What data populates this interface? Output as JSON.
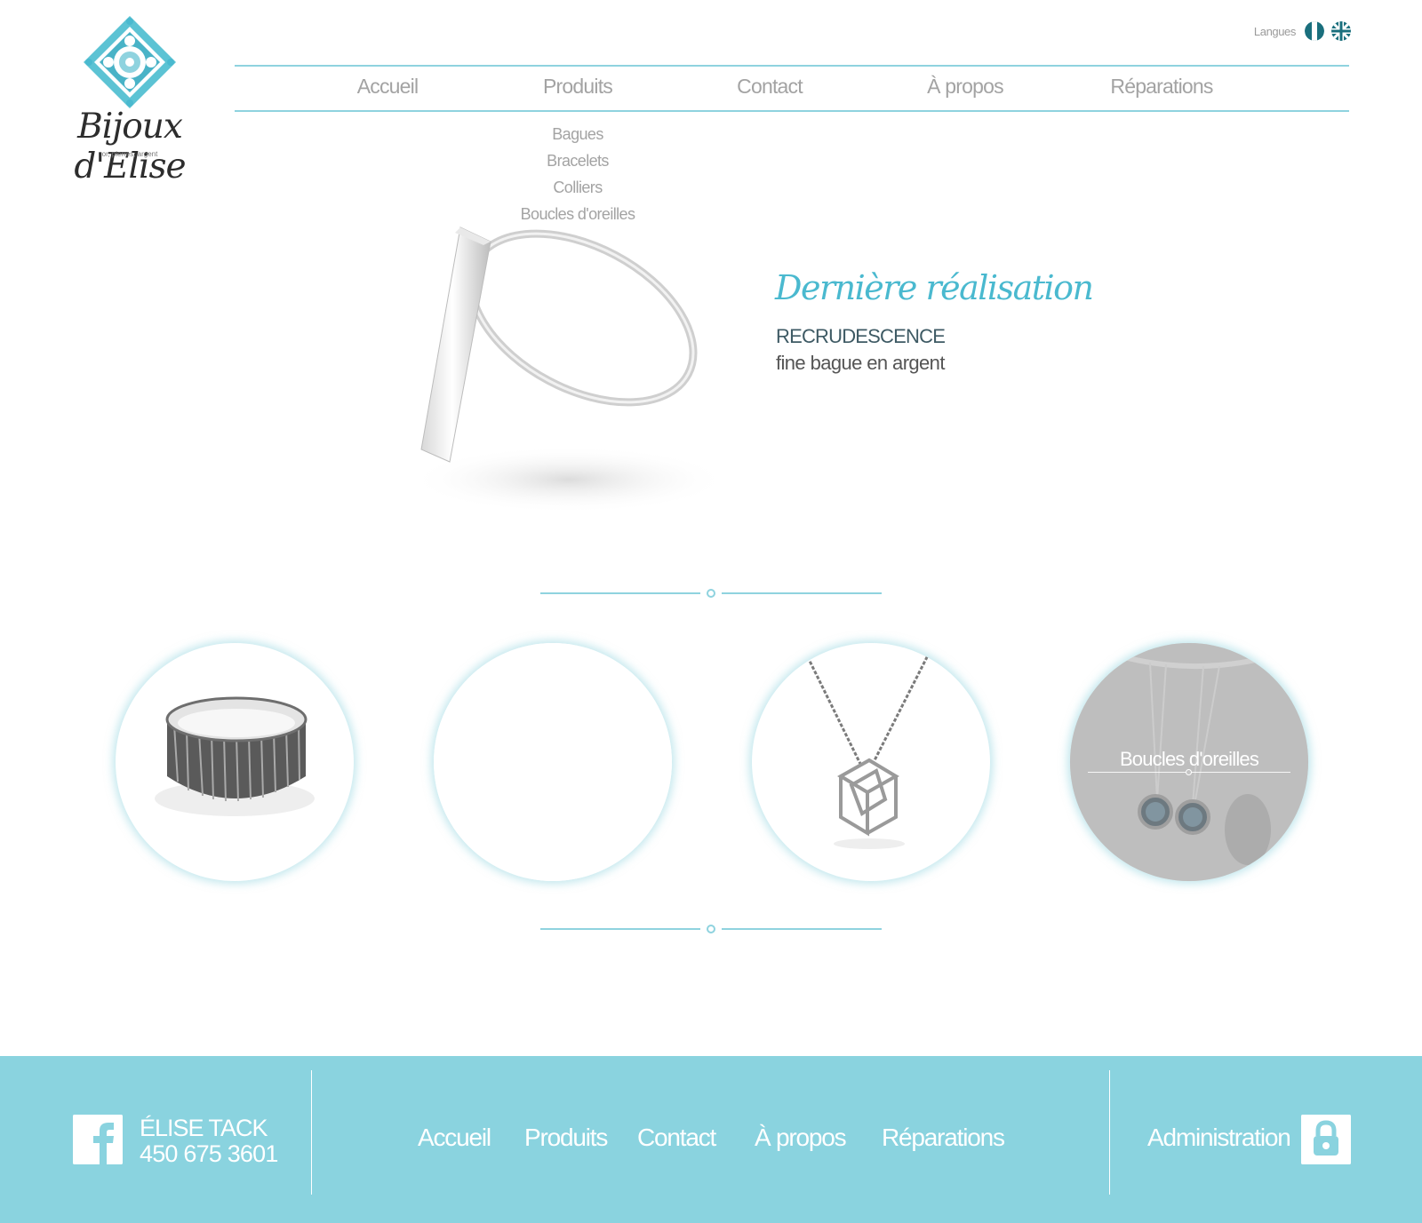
{
  "brand": {
    "name": "Bijoux d'Elise",
    "tagline": "or, pierres, argent"
  },
  "languages": {
    "label": "Langues",
    "options": [
      "flag-fr-icon",
      "flag-en-icon"
    ]
  },
  "nav": {
    "items": [
      "Accueil",
      "Produits",
      "Contact",
      "À propos",
      "Réparations"
    ],
    "products_submenu": [
      "Bagues",
      "Bracelets",
      "Colliers",
      "Boucles d'oreilles"
    ]
  },
  "hero": {
    "title": "Dernière réalisation",
    "product_name": "RECRUDESCENCE",
    "product_desc": "fine bague en argent"
  },
  "categories": {
    "hover_label": "Boucles d'oreilles",
    "icons": [
      "textured-ring-image",
      "empty-category-image",
      "cube-necklace-image",
      "earrings-image"
    ]
  },
  "footer": {
    "owner_name": "ÉLISE TACK",
    "owner_phone": "450 675 3601",
    "nav": [
      "Accueil",
      "Produits",
      "Contact",
      "À propos",
      "Réparations"
    ],
    "admin_label": "Administration"
  },
  "colors": {
    "accent": "#4ab9cf",
    "nav_line": "#8fd3df",
    "footer_bg": "#8ad3df",
    "flag_teal": "#1a6f7d"
  }
}
